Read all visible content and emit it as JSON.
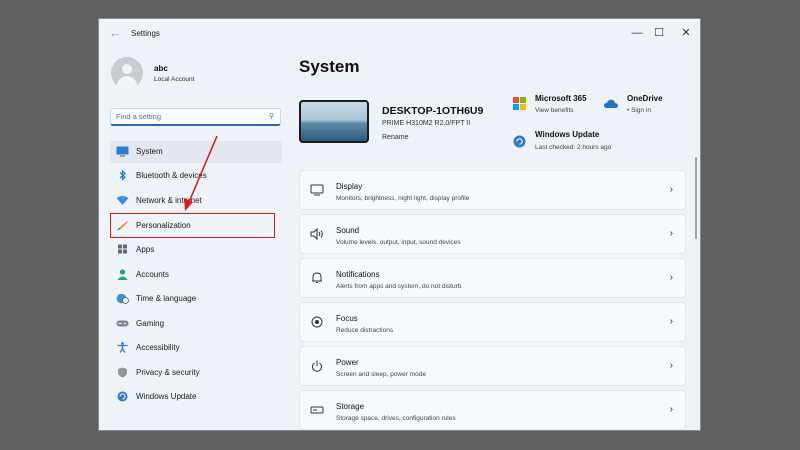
{
  "window": {
    "title": "Settings",
    "controls": {
      "minimize": "—",
      "maximize": "☐",
      "close": "✕"
    }
  },
  "profile": {
    "name": "abc",
    "account": "Local Account"
  },
  "search": {
    "placeholder": "Find a setting",
    "icon": "search-icon"
  },
  "nav": {
    "items": [
      {
        "label": "System",
        "icon": "monitor-icon",
        "selected": true
      },
      {
        "label": "Bluetooth & devices",
        "icon": "bluetooth-icon"
      },
      {
        "label": "Network & internet",
        "icon": "wifi-icon"
      },
      {
        "label": "Personalization",
        "icon": "brush-icon",
        "highlighted": true
      },
      {
        "label": "Apps",
        "icon": "apps-icon"
      },
      {
        "label": "Accounts",
        "icon": "person-icon"
      },
      {
        "label": "Time & language",
        "icon": "globe-clock-icon"
      },
      {
        "label": "Gaming",
        "icon": "gamepad-icon"
      },
      {
        "label": "Accessibility",
        "icon": "accessibility-icon"
      },
      {
        "label": "Privacy & security",
        "icon": "shield-icon"
      },
      {
        "label": "Windows Update",
        "icon": "update-icon"
      }
    ]
  },
  "main": {
    "title": "System",
    "device": {
      "name": "DESKTOP-1OTH6U9",
      "model": "PRIME H310M2 R2.0/FPT II",
      "rename": "Rename"
    },
    "quick_links": [
      {
        "title": "Microsoft 365",
        "sub": "View benefits",
        "icon": "microsoft-logo-icon"
      },
      {
        "title": "OneDrive",
        "sub": "• Sign in",
        "icon": "onedrive-cloud-icon"
      },
      {
        "title": "Windows Update",
        "sub": "Last checked: 2 hours ago",
        "icon": "update-icon"
      }
    ],
    "cards": [
      {
        "title": "Display",
        "sub": "Monitors, brightness, night light, display profile",
        "icon": "display-icon"
      },
      {
        "title": "Sound",
        "sub": "Volume levels, output, input, sound devices",
        "icon": "speaker-icon"
      },
      {
        "title": "Notifications",
        "sub": "Alerts from apps and system, do not disturb",
        "icon": "bell-icon"
      },
      {
        "title": "Focus",
        "sub": "Reduce distractions",
        "icon": "focus-icon"
      },
      {
        "title": "Power",
        "sub": "Screen and sleep, power mode",
        "icon": "power-icon"
      },
      {
        "title": "Storage",
        "sub": "Storage space, drives, configuration rules",
        "icon": "storage-icon"
      }
    ],
    "chevron": "›"
  },
  "colors": {
    "background": "#5f5f5f",
    "window": "#eef3f8",
    "accent": "#2b6cb0",
    "annotation": "#d21f1f"
  }
}
